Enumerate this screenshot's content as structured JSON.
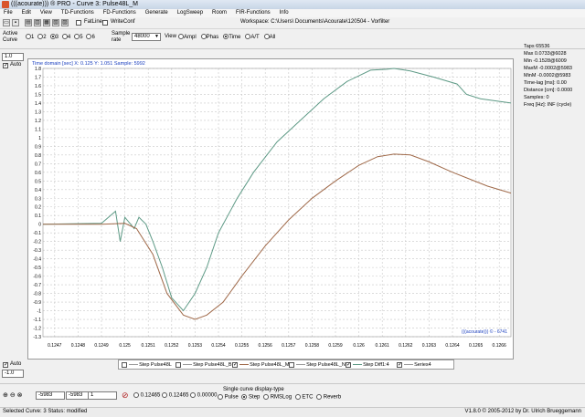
{
  "window": {
    "title": "(((acourate))) ® PRO - Curve 3: Pulse48L_M"
  },
  "menu": [
    "File",
    "Edit",
    "View",
    "TD-Functions",
    "FD-Functions",
    "Generate",
    "LogSweep",
    "Room",
    "FIR-Functions",
    "Info"
  ],
  "toolbar": {
    "fatline_label": "FatLine",
    "writeconf_label": "WriteConf",
    "workspace_label": "Workspace: C:\\Users\\                Documents\\Acourate\\120504 - Vorfilter"
  },
  "controls": {
    "active_curve_label": "Active Curve",
    "curves": [
      "1",
      "2",
      "3",
      "4",
      "5",
      "6"
    ],
    "selected_curve": "3",
    "sample_rate_label": "Sample rate",
    "sample_rate_value": "48000",
    "view_label": "View",
    "view_options": [
      "Ampl",
      "Phas",
      "Time",
      "A/T",
      "All"
    ],
    "selected_view": "Time"
  },
  "yaxis_controls": {
    "max_value": "1.0",
    "min_value": "-1.0",
    "auto_label": "Auto"
  },
  "chart_header": {
    "text": "Time domain [sec]   X: 0.125   Y: 1.051   Sample: 5992"
  },
  "watermark": "(((acourate))) © - 6741",
  "info_panel": [
    "Taps 65536",
    "Max 0.0733@6028",
    "Min -0.1528@6009",
    "MaxM -0.0002@5983",
    "MinM -0.0002@5983",
    "Time-lag [ms]: 0.00",
    "Distance [cm]: 0.0000",
    "Samples: 0",
    "Freq [Hz]: INF (cycle)"
  ],
  "legend": [
    {
      "label": "Step Pulse48L",
      "checked": false,
      "color": "#9a9a9a"
    },
    {
      "label": "Step Pulse48L_B",
      "checked": false,
      "color": "#9a9a9a"
    },
    {
      "label": "Step Pulse48L_M",
      "checked": true,
      "color": "#a06a4a"
    },
    {
      "label": "Step Pulse48L_N",
      "checked": false,
      "color": "#9a9a9a"
    },
    {
      "label": "Step Diff1:4",
      "checked": true,
      "color": "#5e9a86"
    },
    {
      "label": "Series4",
      "checked": true,
      "color": "#9a9a9a"
    }
  ],
  "bottom": {
    "field1": "-5983",
    "field2": "-5983",
    "field3": "1",
    "range_values": [
      "0.12465",
      "0.12465",
      "0.00000"
    ],
    "display_type_label": "Single curve display-type",
    "display_types": [
      "Pulse",
      "Step",
      "RMSLog",
      "ETC",
      "Reverb"
    ],
    "selected_display": "Step"
  },
  "status": {
    "left": "Selected Curve: 3   Status: modified",
    "right": "V1.8.0 © 2005-2012 by Dr. Ulrich Brueggemann"
  },
  "chart_data": {
    "type": "line",
    "xlim": [
      0.12465,
      0.12665
    ],
    "ylim": [
      -1.3,
      1.8
    ],
    "x_ticks": [
      "0.1247",
      "0.1248",
      "0.1249",
      "0.125",
      "0.1251",
      "0.1252",
      "0.1253",
      "0.1254",
      "0.1255",
      "0.1256",
      "0.1257",
      "0.1258",
      "0.1259",
      "0.126",
      "0.1261",
      "0.1262",
      "0.1263",
      "0.1264",
      "0.1265",
      "0.1266"
    ],
    "y_ticks": [
      "1.8",
      "1.7",
      "1.6",
      "1.5",
      "1.4",
      "1.3",
      "1.2",
      "1.1",
      "1",
      "0.9",
      "0.8",
      "0.7",
      "0.6",
      "0.5",
      "0.4",
      "0.3",
      "0.2",
      "0.1",
      "0",
      "-0.1",
      "-0.2",
      "-0.3",
      "-0.4",
      "-0.5",
      "-0.6",
      "-0.7",
      "-0.8",
      "-0.9",
      "-1",
      "-1.1",
      "-1.2",
      "-1.3"
    ],
    "grid": true,
    "series": [
      {
        "name": "Step Diff1:4",
        "color": "#5e9a86",
        "x": [
          0.12465,
          0.1249,
          0.12496,
          0.12498,
          0.125,
          0.12504,
          0.12506,
          0.12509,
          0.12512,
          0.12516,
          0.1252,
          0.12525,
          0.1253,
          0.12535,
          0.1254,
          0.12548,
          0.12555,
          0.12565,
          0.12575,
          0.12585,
          0.12595,
          0.12605,
          0.12612,
          0.12615,
          0.12622,
          0.12632,
          0.12642,
          0.12646,
          0.12652,
          0.12665
        ],
        "y": [
          0.0,
          0.01,
          0.15,
          -0.2,
          0.08,
          -0.05,
          0.08,
          0.0,
          -0.2,
          -0.5,
          -0.85,
          -1.0,
          -0.8,
          -0.5,
          -0.1,
          0.3,
          0.6,
          0.95,
          1.2,
          1.45,
          1.65,
          1.78,
          1.79,
          1.8,
          1.77,
          1.7,
          1.62,
          1.5,
          1.45,
          1.4
        ]
      },
      {
        "name": "Step Pulse48L_M",
        "color": "#a06a4a",
        "x": [
          0.12465,
          0.1249,
          0.125,
          0.12505,
          0.12512,
          0.12518,
          0.12525,
          0.1253,
          0.12535,
          0.12542,
          0.1255,
          0.1256,
          0.1257,
          0.1258,
          0.1259,
          0.126,
          0.12608,
          0.12615,
          0.12622,
          0.1263,
          0.1264,
          0.12655,
          0.12665
        ],
        "y": [
          0.0,
          0.0,
          0.01,
          -0.05,
          -0.35,
          -0.8,
          -1.05,
          -1.1,
          -1.05,
          -0.9,
          -0.6,
          -0.25,
          0.05,
          0.3,
          0.5,
          0.68,
          0.78,
          0.81,
          0.8,
          0.72,
          0.6,
          0.44,
          0.36
        ]
      }
    ]
  }
}
